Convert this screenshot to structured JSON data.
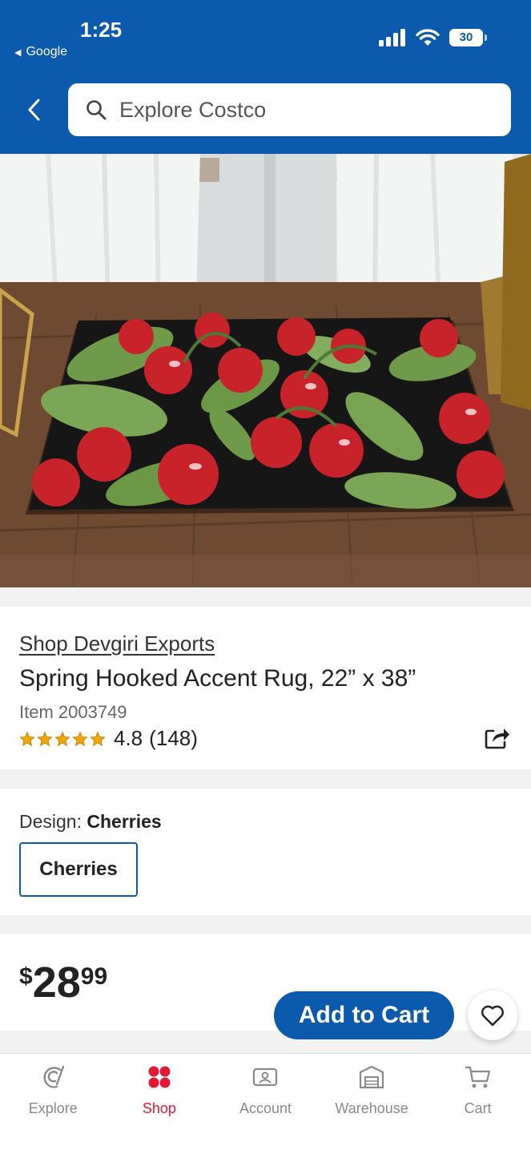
{
  "status_bar": {
    "time": "1:25",
    "back_app": "Google",
    "battery": "30"
  },
  "search": {
    "placeholder": "Explore Costco"
  },
  "hero": {
    "image_icon": "rug-photo"
  },
  "product": {
    "brand_link": "Shop Devgiri Exports",
    "title": "Spring Hooked Accent Rug, 22” x 38”",
    "item_number": "Item 2003749",
    "rating_value": "4.8",
    "rating_count": "(148)",
    "stars_out_of_5": 4.8
  },
  "design": {
    "label": "Design:",
    "selected": "Cherries",
    "options": [
      "Cherries"
    ]
  },
  "price": {
    "currency": "$",
    "dollars": "28",
    "cents": "99"
  },
  "actions": {
    "add_to_cart": "Add to Cart"
  },
  "tabbar": {
    "items": [
      {
        "label": "Explore",
        "icon": "explore-icon"
      },
      {
        "label": "Shop",
        "icon": "shop-icon"
      },
      {
        "label": "Account",
        "icon": "account-icon"
      },
      {
        "label": "Warehouse",
        "icon": "warehouse-icon"
      },
      {
        "label": "Cart",
        "icon": "cart-icon"
      }
    ],
    "active": "Shop"
  },
  "colors": {
    "brand_blue": "#0b5aad",
    "active_red": "#e31837",
    "star_gold": "#f0a500"
  }
}
